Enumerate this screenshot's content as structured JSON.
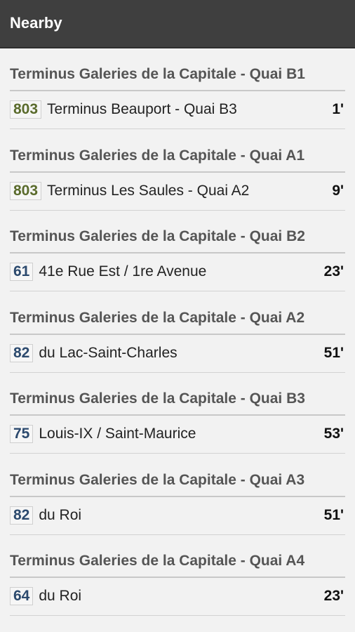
{
  "appbar": {
    "title": "Nearby"
  },
  "colors": {
    "route_green": "#5a6b2c",
    "route_blue": "#2c4a6e"
  },
  "sections": [
    {
      "stop": "Terminus Galeries de la Capitale - Quai B1",
      "route": "803",
      "route_color": "#5a6b2c",
      "destination": "Terminus Beauport - Quai B3",
      "eta": "1'"
    },
    {
      "stop": "Terminus Galeries de la Capitale - Quai A1",
      "route": "803",
      "route_color": "#5a6b2c",
      "destination": "Terminus Les Saules - Quai A2",
      "eta": "9'"
    },
    {
      "stop": "Terminus Galeries de la Capitale - Quai B2",
      "route": "61",
      "route_color": "#2c4a6e",
      "destination": "41e Rue Est / 1re Avenue",
      "eta": "23'"
    },
    {
      "stop": "Terminus Galeries de la Capitale - Quai A2",
      "route": "82",
      "route_color": "#2c4a6e",
      "destination": "du Lac-Saint-Charles",
      "eta": "51'"
    },
    {
      "stop": "Terminus Galeries de la Capitale - Quai B3",
      "route": "75",
      "route_color": "#2c4a6e",
      "destination": "Louis-IX / Saint-Maurice",
      "eta": "53'"
    },
    {
      "stop": "Terminus Galeries de la Capitale - Quai A3",
      "route": "82",
      "route_color": "#2c4a6e",
      "destination": "du Roi",
      "eta": "51'"
    },
    {
      "stop": "Terminus Galeries de la Capitale - Quai A4",
      "route": "64",
      "route_color": "#2c4a6e",
      "destination": "du Roi",
      "eta": "23'"
    }
  ]
}
